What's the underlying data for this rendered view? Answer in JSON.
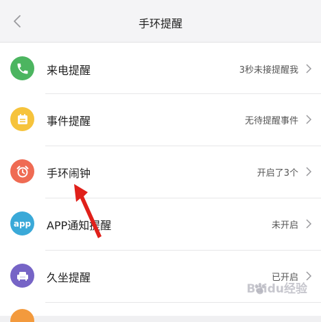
{
  "header": {
    "title": "手环提醒",
    "back_icon": "chevron-left-icon"
  },
  "rows": [
    {
      "label": "来电提醒",
      "value": "3秒未接提醒我",
      "icon": "phone-icon",
      "color": "#4cb560"
    },
    {
      "label": "事件提醒",
      "value": "无待提醒事件",
      "icon": "calendar-icon",
      "color": "#f6c33c"
    },
    {
      "label": "手环闹钟",
      "value": "开启了3个",
      "icon": "alarm-clock-icon",
      "color": "#ef6b53"
    },
    {
      "label": "APP通知提醒",
      "value": "未开启",
      "icon": "app-icon",
      "icon_text": "app",
      "color": "#3aa9d8"
    },
    {
      "label": "久坐提醒",
      "value": "已开启",
      "icon": "sofa-icon",
      "color": "#7664c6"
    }
  ],
  "annotation": {
    "arrow_color": "#e0201a"
  },
  "watermark": {
    "text": "Baidu经验"
  }
}
